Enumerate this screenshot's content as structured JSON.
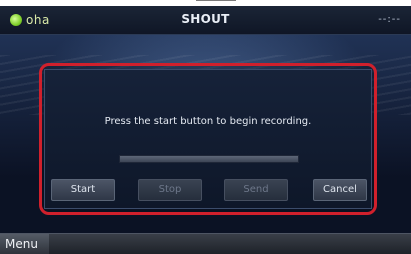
{
  "app": {
    "logo_text": "oha",
    "title": "SHOUT",
    "clock": "--:--"
  },
  "dialog": {
    "message": "Press the start button to begin recording.",
    "progress": 0
  },
  "buttons": {
    "start": "Start",
    "stop": "Stop",
    "send": "Send",
    "cancel": "Cancel"
  },
  "footer": {
    "menu": "Menu"
  },
  "colors": {
    "highlight_border": "#d0202c",
    "logo_green": "#7fcf2a"
  }
}
